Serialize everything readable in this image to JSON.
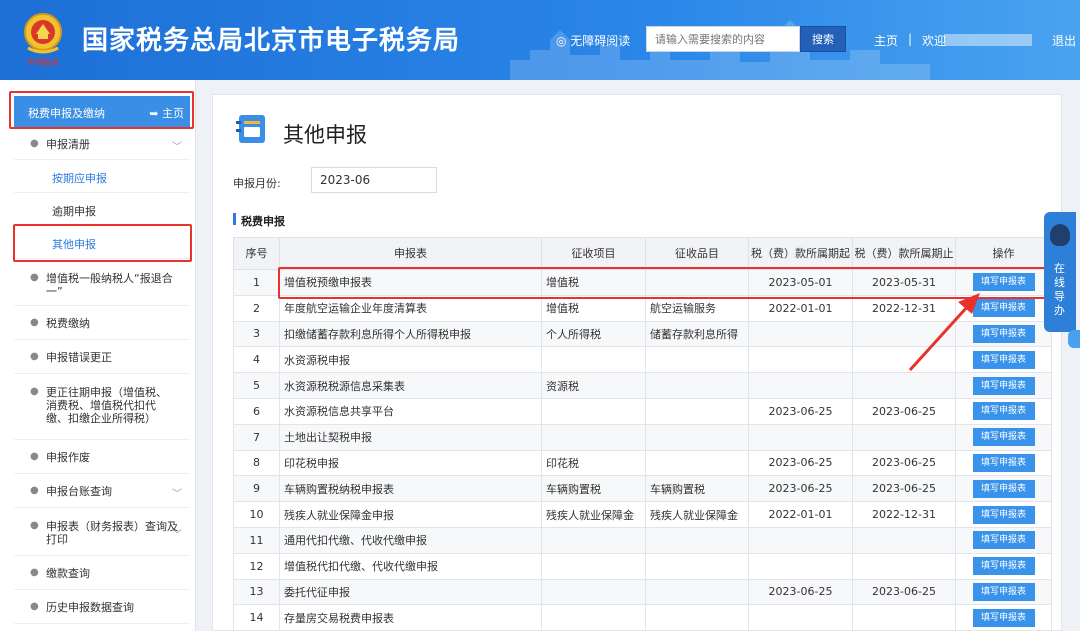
{
  "header": {
    "title": "国家税务总局北京市电子税务局",
    "emblem_caption": "中国税务",
    "accessibility": "无障碍阅读",
    "search_placeholder": "请输入需要搜索的内容",
    "search_button": "搜索",
    "home": "主页",
    "separator": "|",
    "welcome": "欢迎",
    "logout": "退出"
  },
  "sidebar": {
    "head_title": "税费申报及缴纳",
    "head_home": "主页",
    "items": [
      {
        "label": "申报清册",
        "expandable": true
      },
      {
        "label": "按期应申报",
        "sub": true,
        "active": true
      },
      {
        "label": "逾期申报",
        "sub": true
      },
      {
        "label": "其他申报",
        "sub": true,
        "active": true
      },
      {
        "label": "增值税一般纳税人“报退合一”"
      },
      {
        "label": "税费缴纳"
      },
      {
        "label": "申报错误更正"
      },
      {
        "label": "更正往期申报（增值税、消费税、增值税代扣代缴、扣缴企业所得税）"
      },
      {
        "label": "申报作废"
      },
      {
        "label": "申报台账查询",
        "expandable": true
      },
      {
        "label": "申报表（财务报表）查询及打印",
        "expandable": true
      },
      {
        "label": "缴款查询"
      },
      {
        "label": "历史申报数据查询"
      }
    ]
  },
  "main": {
    "title": "其他申报",
    "month_label": "申报月份:",
    "month_value": "2023-06",
    "section_title": "税费申报",
    "columns": [
      "序号",
      "申报表",
      "征收项目",
      "征收品目",
      "税（费）款所属期起",
      "税（费）款所属期止",
      "操作"
    ],
    "action_label": "填写申报表",
    "rows": [
      {
        "no": "1",
        "form": "增值税预缴申报表",
        "item": "增值税",
        "category": "",
        "start": "2023-05-01",
        "end": "2023-05-31"
      },
      {
        "no": "2",
        "form": "年度航空运输企业年度清算表",
        "item": "增值税",
        "category": "航空运输服务",
        "start": "2022-01-01",
        "end": "2022-12-31"
      },
      {
        "no": "3",
        "form": "扣缴储蓄存款利息所得个人所得税申报",
        "item": "个人所得税",
        "category": "储蓄存款利息所得",
        "start": "",
        "end": ""
      },
      {
        "no": "4",
        "form": "水资源税申报",
        "item": "",
        "category": "",
        "start": "",
        "end": ""
      },
      {
        "no": "5",
        "form": "水资源税税源信息采集表",
        "item": "资源税",
        "category": "",
        "start": "",
        "end": ""
      },
      {
        "no": "6",
        "form": "水资源税信息共享平台",
        "item": "",
        "category": "",
        "start": "2023-06-25",
        "end": "2023-06-25"
      },
      {
        "no": "7",
        "form": "土地出让契税申报",
        "item": "",
        "category": "",
        "start": "",
        "end": ""
      },
      {
        "no": "8",
        "form": "印花税申报",
        "item": "印花税",
        "category": "",
        "start": "2023-06-25",
        "end": "2023-06-25"
      },
      {
        "no": "9",
        "form": "车辆购置税纳税申报表",
        "item": "车辆购置税",
        "category": "车辆购置税",
        "start": "2023-06-25",
        "end": "2023-06-25"
      },
      {
        "no": "10",
        "form": "残疾人就业保障金申报",
        "item": "残疾人就业保障金",
        "category": "残疾人就业保障金",
        "start": "2022-01-01",
        "end": "2022-12-31"
      },
      {
        "no": "11",
        "form": "通用代扣代缴、代收代缴申报",
        "item": "",
        "category": "",
        "start": "",
        "end": ""
      },
      {
        "no": "12",
        "form": "增值税代扣代缴、代收代缴申报",
        "item": "",
        "category": "",
        "start": "",
        "end": ""
      },
      {
        "no": "13",
        "form": "委托代征申报",
        "item": "",
        "category": "",
        "start": "2023-06-25",
        "end": "2023-06-25"
      },
      {
        "no": "14",
        "form": "存量房交易税费申报表",
        "item": "",
        "category": "",
        "start": "",
        "end": ""
      }
    ]
  },
  "float": {
    "online_help": "在线导办"
  },
  "colors": {
    "header": "#2a86e8",
    "accent": "#3a8ee6",
    "highlight": "#e8322b",
    "active_link": "#2d7be0"
  }
}
